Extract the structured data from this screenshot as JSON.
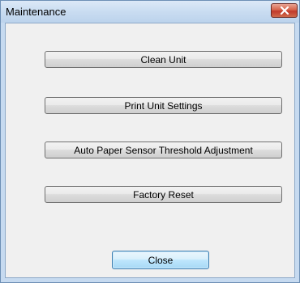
{
  "window": {
    "title": "Maintenance"
  },
  "buttons": {
    "clean_unit": "Clean Unit",
    "print_unit_settings": "Print Unit Settings",
    "auto_paper_sensor": "Auto Paper Sensor Threshold Adjustment",
    "factory_reset": "Factory Reset",
    "close": "Close"
  },
  "icons": {
    "close": "close-icon"
  },
  "colors": {
    "titlebar": "#c9dcf1",
    "close_button": "#c0392b",
    "client_background": "#f0f0f0",
    "default_button_border": "#3c7fb1"
  }
}
